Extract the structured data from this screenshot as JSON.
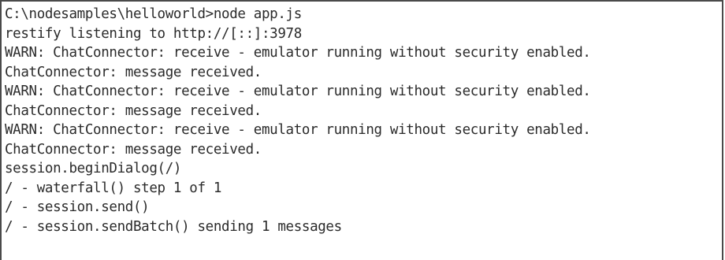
{
  "console": {
    "lines": [
      "C:\\nodesamples\\helloworld>node app.js",
      "restify listening to http://[::]:3978",
      "WARN: ChatConnector: receive - emulator running without security enabled.",
      "ChatConnector: message received.",
      "WARN: ChatConnector: receive - emulator running without security enabled.",
      "ChatConnector: message received.",
      "WARN: ChatConnector: receive - emulator running without security enabled.",
      "ChatConnector: message received.",
      "session.beginDialog(/)",
      "/ - waterfall() step 1 of 1",
      "/ - session.send()",
      "/ - session.sendBatch() sending 1 messages"
    ]
  }
}
